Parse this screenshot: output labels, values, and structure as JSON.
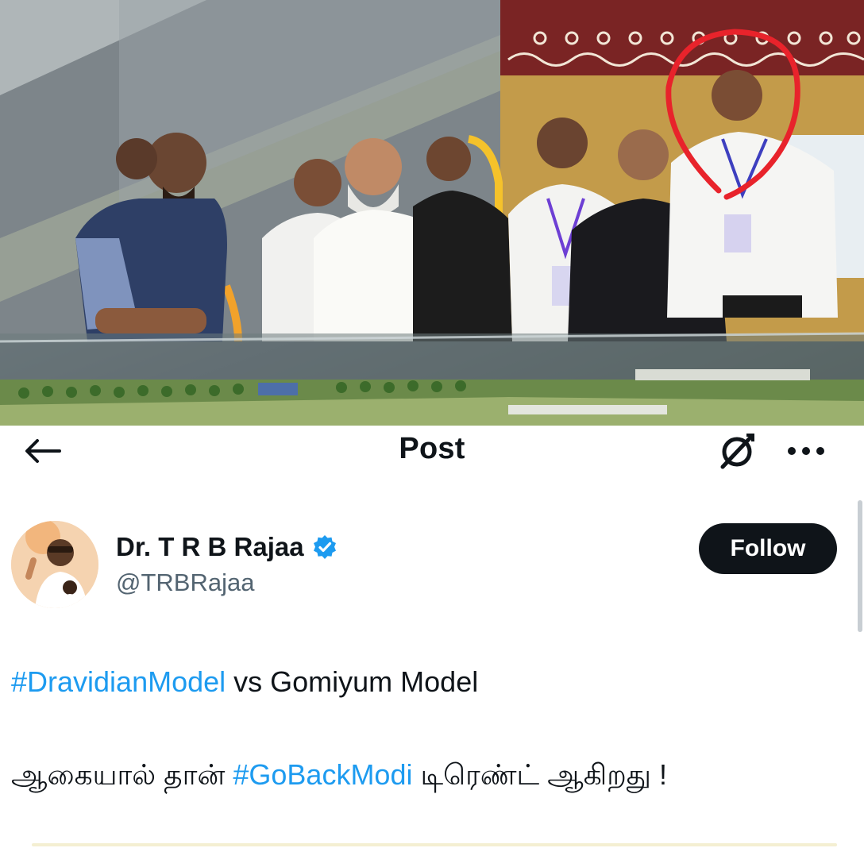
{
  "header": {
    "title": "Post",
    "back_icon": "arrow-left-icon",
    "grok_icon": "grok-icon",
    "more_icon": "more-horizontal-icon"
  },
  "author": {
    "display_name": "Dr. T R B Rajaa",
    "handle": "@TRBRajaa",
    "verified": true,
    "verified_color": "#1d9bf0",
    "follow_label": "Follow"
  },
  "tweet": {
    "line1": {
      "hashtag": "#DravidianModel",
      "rest": " vs Gomiyum Model"
    },
    "line2": {
      "before": "ஆகையால் தான் ",
      "hashtag": "#GoBackModi",
      "after": " டிரெண்ட் ஆகிறது !"
    }
  },
  "colors": {
    "accent": "#1d9bf0",
    "text": "#0f1419",
    "secondary_text": "#536471",
    "follow_bg": "#0f1419",
    "annotation_circle": "#e8232b"
  }
}
